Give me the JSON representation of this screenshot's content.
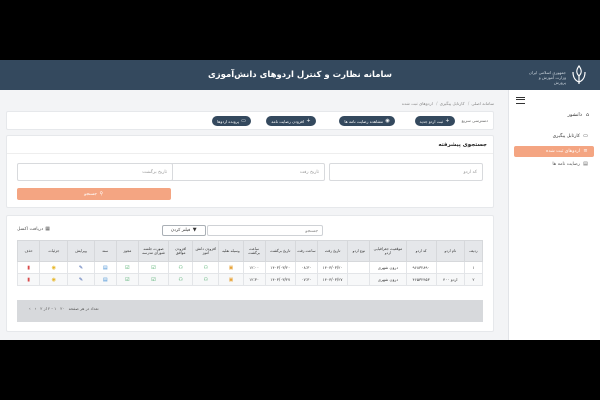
{
  "app": {
    "title": "سامانه نظارت و کنترل اردوهای دانش‌آموزی",
    "logo_text": "جمهوری اسلامی ایران وزارت آموزش و پرورش"
  },
  "sidebar": {
    "user_label": "دانشور",
    "items": [
      {
        "label": "کارتابل پیگیری"
      },
      {
        "label": "اردوهای ثبت شده"
      },
      {
        "label": "رضایت نامه ها"
      }
    ]
  },
  "breadcrumb": [
    "سامانه اصلی",
    "کارتابل پیگیری",
    "اردوهای ثبت شده"
  ],
  "toolbar": {
    "quick_label": "دسترسی سریع",
    "buttons": [
      "ثبت اردو جدید",
      "مشاهده رضایت نامه ها",
      "افزودن رضایت نامه",
      "پرونده اردوها"
    ]
  },
  "search": {
    "title": "جستجوی پیشرفته",
    "fields": [
      {
        "placeholder": "کد اردو"
      },
      {
        "placeholder": "تاریخ رفت"
      },
      {
        "placeholder": "تاریخ برگشت"
      }
    ],
    "button_label": "جستجو"
  },
  "table_tools": {
    "search_placeholder": "جستجو",
    "filter_label": "فیلتر کردن",
    "excel_label": "دریافت اکسل"
  },
  "table": {
    "headers": [
      "ردیف",
      "نام اردو",
      "کد اردو",
      "موقعیت جغرافیایی اردو",
      "نوع اردو",
      "تاریخ رفت",
      "ساعت رفت",
      "تاریخ برگشت",
      "ساعت برگشت",
      "وسیله نقلیه",
      "افزودن دانش آموز",
      "افزودن مواقق",
      "صورت جلسه شورای مدرسه",
      "مجوز",
      "سند",
      "ویرایش",
      "جزئیات",
      "حذف"
    ],
    "rows": [
      {
        "num": "۱",
        "name": "",
        "code": "۹۶۸۳۲۸۹۰",
        "location": "درون شهری",
        "type": "",
        "go_date": "۱۴۰۳/۰۳/۲۰",
        "go_time": "۰۸:۳۰",
        "back_date": "۱۴۰۳/۰۳/۲۰",
        "back_time": "۱۲:۰۰"
      },
      {
        "num": "۲",
        "name": "اردو ۴۰۰",
        "code": "۴۶۵۳۲۴۵۳",
        "location": "درون شهری",
        "type": "",
        "go_date": "۱۴۰۳/۰۳/۲۷",
        "go_time": "۰۷:۳۰",
        "back_date": "۱۴۰۳/۰۳/۲۷",
        "back_time": "۱۲:۳۰"
      }
    ]
  },
  "pager": {
    "rows_label": "تعداد در هر صفحه",
    "rows_value": "۲۰",
    "range": "۱ - ۲ از ۲"
  },
  "colors": {
    "header_bg": "#34495e",
    "accent": "#f4a582"
  }
}
